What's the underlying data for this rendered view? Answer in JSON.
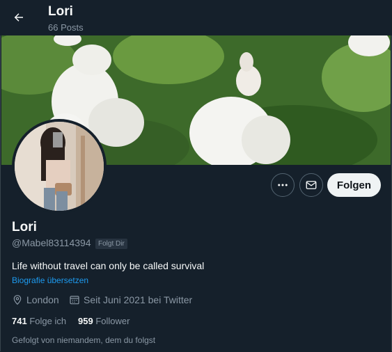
{
  "header": {
    "name": "Lori",
    "posts": "66 Posts"
  },
  "profile": {
    "name": "Lori",
    "handle": "@Mabel83114394",
    "follows_you_badge": "Folgt Dir",
    "bio": "Life without travel can only be called survival",
    "translate_link": "Biografie übersetzen",
    "location": "London",
    "joined": "Seit Juni 2021 bei Twitter",
    "following_count": "741",
    "following_label": "Folge ich",
    "followers_count": "959",
    "followers_label": "Follower",
    "followed_by_text": "Gefolgt von niemandem, dem du folgst"
  },
  "actions": {
    "follow_label": "Folgen"
  },
  "icons": {
    "back": "arrow-left-icon",
    "more": "more-horizontal-icon",
    "message": "envelope-icon",
    "location": "location-pin-icon",
    "calendar": "calendar-icon"
  },
  "colors": {
    "background": "#15202b",
    "link": "#1d9bf0",
    "muted": "#8b98a5",
    "follow_button": "#eff3f4"
  }
}
